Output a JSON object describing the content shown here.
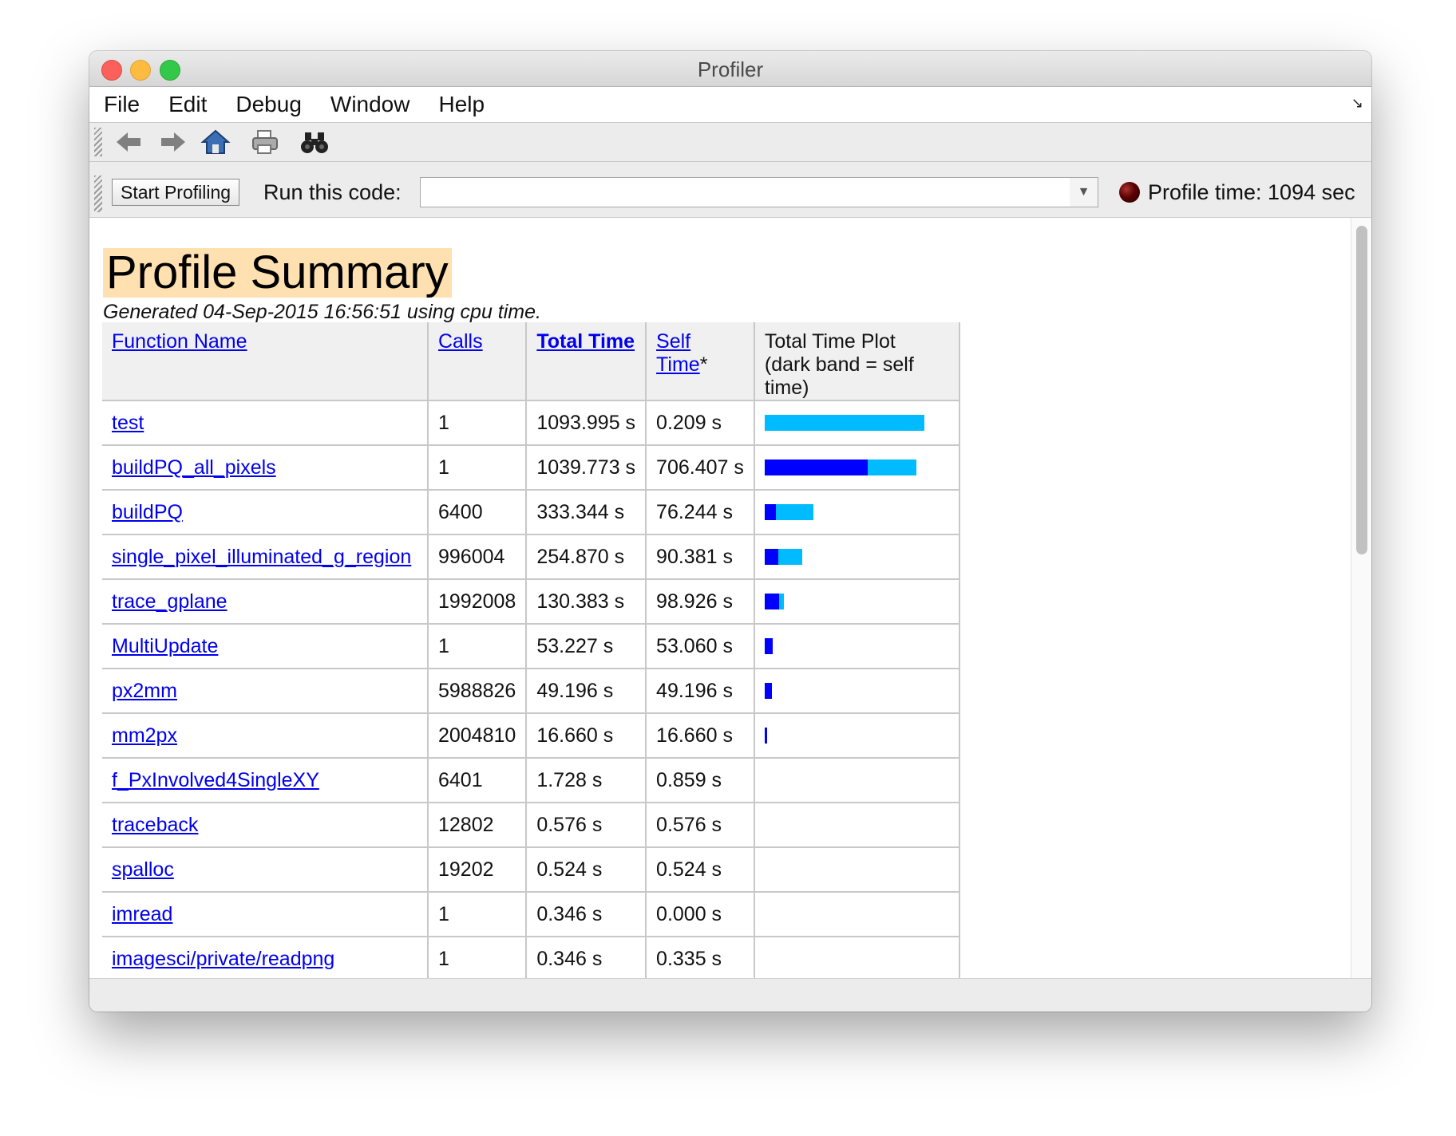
{
  "window": {
    "title": "Profiler"
  },
  "menu": [
    "File",
    "Edit",
    "Debug",
    "Window",
    "Help"
  ],
  "toolbar": {
    "icons": [
      "back-arrow-icon",
      "forward-arrow-icon",
      "home-icon",
      "print-icon",
      "find-binoculars-icon"
    ]
  },
  "runbar": {
    "start_label": "Start Profiling",
    "run_label": "Run this code:",
    "run_value": "",
    "profile_time": "Profile time: 1094 sec"
  },
  "summary": {
    "title": "Profile Summary",
    "generated": "Generated 04-Sep-2015 16:56:51 using cpu time.",
    "columns": {
      "function_name": "Function Name",
      "calls": "Calls",
      "total_time": "Total Time",
      "self_time": "Self Time",
      "self_time_mark": "*",
      "plot_line1": "Total Time Plot",
      "plot_line2": "(dark band = self time)"
    },
    "rows": [
      {
        "name": "test",
        "calls": "1",
        "total": "1093.995 s",
        "self": "0.209 s",
        "total_frac": 1.0,
        "self_frac": 0.0002
      },
      {
        "name": "buildPQ_all_pixels",
        "calls": "1",
        "total": "1039.773 s",
        "self": "706.407 s",
        "total_frac": 0.9504,
        "self_frac": 0.6457
      },
      {
        "name": "buildPQ",
        "calls": "6400",
        "total": "333.344 s",
        "self": "76.244 s",
        "total_frac": 0.3047,
        "self_frac": 0.0697
      },
      {
        "name": "single_pixel_illuminated_g_region",
        "calls": "996004",
        "total": "254.870 s",
        "self": "90.381 s",
        "total_frac": 0.233,
        "self_frac": 0.0826
      },
      {
        "name": "trace_gplane",
        "calls": "1992008",
        "total": "130.383 s",
        "self": "98.926 s",
        "total_frac": 0.1192,
        "self_frac": 0.0904
      },
      {
        "name": "MultiUpdate",
        "calls": "1",
        "total": "53.227 s",
        "self": "53.060 s",
        "total_frac": 0.0487,
        "self_frac": 0.0485
      },
      {
        "name": "px2mm",
        "calls": "5988826",
        "total": "49.196 s",
        "self": "49.196 s",
        "total_frac": 0.045,
        "self_frac": 0.045
      },
      {
        "name": "mm2px",
        "calls": "2004810",
        "total": "16.660 s",
        "self": "16.660 s",
        "total_frac": 0.0152,
        "self_frac": 0.0152
      },
      {
        "name": "f_PxInvolved4SingleXY",
        "calls": "6401",
        "total": "1.728 s",
        "self": "0.859 s",
        "total_frac": 0.0016,
        "self_frac": 0.0008
      },
      {
        "name": "traceback",
        "calls": "12802",
        "total": "0.576 s",
        "self": "0.576 s",
        "total_frac": 0.0005,
        "self_frac": 0.0005
      },
      {
        "name": "spalloc",
        "calls": "19202",
        "total": "0.524 s",
        "self": "0.524 s",
        "total_frac": 0.0005,
        "self_frac": 0.0005
      },
      {
        "name": "imread",
        "calls": "1",
        "total": "0.346 s",
        "self": "0.000 s",
        "total_frac": 0.0003,
        "self_frac": 0.0
      },
      {
        "name": "imagesci/private/readpng",
        "calls": "1",
        "total": "0.346 s",
        "self": "0.335 s",
        "total_frac": 0.0003,
        "self_frac": 0.0003
      }
    ]
  },
  "colors": {
    "total_bar": "#00bbff",
    "self_bar": "#0000ff",
    "title_highlight": "#ffe0b0",
    "link": "#0000ee"
  }
}
